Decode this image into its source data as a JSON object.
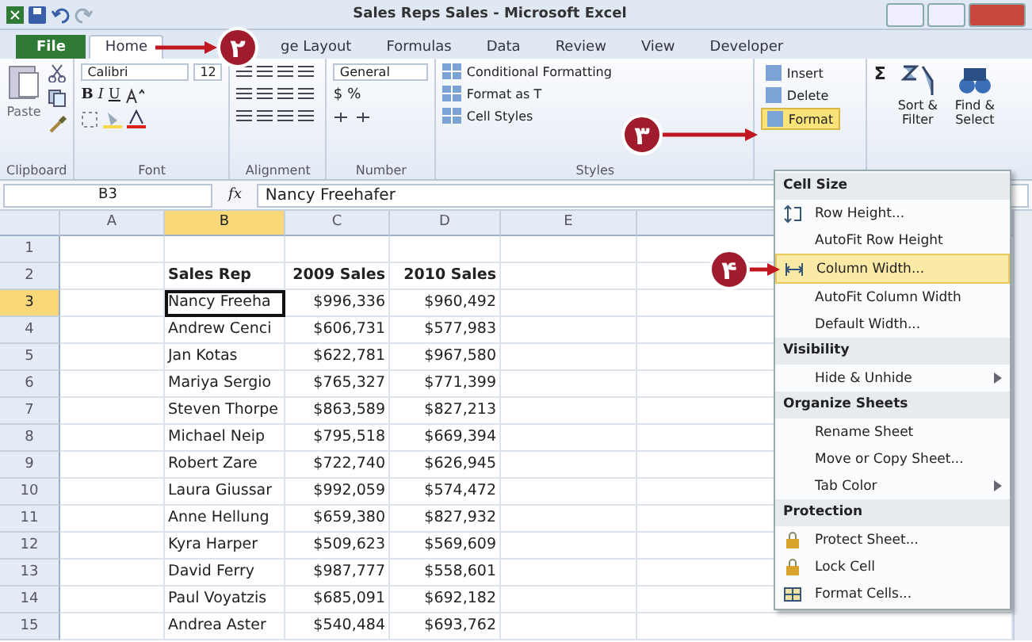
{
  "window": {
    "title": "Sales Reps Sales - Microsoft Excel"
  },
  "tabs": [
    {
      "label": "File",
      "kind": "file",
      "selected": false
    },
    {
      "label": "Home",
      "kind": "tab",
      "selected": true
    },
    {
      "label": "ge Layout",
      "kind": "tab",
      "selected": false
    },
    {
      "label": "Formulas",
      "kind": "tab",
      "selected": false
    },
    {
      "label": "Data",
      "kind": "tab",
      "selected": false
    },
    {
      "label": "Review",
      "kind": "tab",
      "selected": false
    },
    {
      "label": "View",
      "kind": "tab",
      "selected": false
    },
    {
      "label": "Developer",
      "kind": "tab",
      "selected": false
    }
  ],
  "ribbon": {
    "clipboard": {
      "paste": "Paste",
      "label": "Clipboard"
    },
    "font": {
      "name": "Calibri",
      "size": "12",
      "bold": "B",
      "italic": "I",
      "underline": "U",
      "label": "Font"
    },
    "alignment": {
      "label": "Alignment"
    },
    "number": {
      "format": "General",
      "currency": "$",
      "percent": "%",
      "label": "Number"
    },
    "styles": {
      "items": [
        "Conditional Formatting",
        "Format as T",
        "Cell Styles"
      ],
      "label": "Styles"
    },
    "cells": [
      {
        "label": "Insert",
        "selected": false
      },
      {
        "label": "Delete",
        "selected": false
      },
      {
        "label": "Format",
        "selected": true
      }
    ],
    "editing": {
      "sum": "Σ",
      "sort": "Sort & Filter",
      "find": "Find & Select"
    }
  },
  "formula_bar": {
    "name_box": "B3",
    "fx": "fx",
    "value": "Nancy Freehafer"
  },
  "columns": [
    {
      "label": "A",
      "selected": false
    },
    {
      "label": "B",
      "selected": true
    },
    {
      "label": "C",
      "selected": false
    },
    {
      "label": "D",
      "selected": false
    },
    {
      "label": "E",
      "selected": false
    }
  ],
  "rows": [
    {
      "num": "1",
      "kind": "blank",
      "selected": false
    },
    {
      "num": "2",
      "kind": "header",
      "selected": false,
      "rep": "Sales Rep",
      "y2009": "2009 Sales",
      "y2010": "2010 Sales"
    },
    {
      "num": "3",
      "kind": "data",
      "selected": true,
      "rep": "Nancy Freeha",
      "y2009": "$996,336",
      "y2010": "$960,492"
    },
    {
      "num": "4",
      "kind": "data",
      "selected": false,
      "rep": "Andrew Cenci",
      "y2009": "$606,731",
      "y2010": "$577,983"
    },
    {
      "num": "5",
      "kind": "data",
      "selected": false,
      "rep": "Jan Kotas",
      "y2009": "$622,781",
      "y2010": "$967,580"
    },
    {
      "num": "6",
      "kind": "data",
      "selected": false,
      "rep": "Mariya Sergio",
      "y2009": "$765,327",
      "y2010": "$771,399"
    },
    {
      "num": "7",
      "kind": "data",
      "selected": false,
      "rep": "Steven Thorpe",
      "y2009": "$863,589",
      "y2010": "$827,213"
    },
    {
      "num": "8",
      "kind": "data",
      "selected": false,
      "rep": "Michael Neip",
      "y2009": "$795,518",
      "y2010": "$669,394"
    },
    {
      "num": "9",
      "kind": "data",
      "selected": false,
      "rep": "Robert Zare",
      "y2009": "$722,740",
      "y2010": "$626,945"
    },
    {
      "num": "10",
      "kind": "data",
      "selected": false,
      "rep": "Laura Giussar",
      "y2009": "$992,059",
      "y2010": "$574,472"
    },
    {
      "num": "11",
      "kind": "data",
      "selected": false,
      "rep": "Anne Hellung",
      "y2009": "$659,380",
      "y2010": "$827,932"
    },
    {
      "num": "12",
      "kind": "data",
      "selected": false,
      "rep": "Kyra Harper",
      "y2009": "$509,623",
      "y2010": "$569,609"
    },
    {
      "num": "13",
      "kind": "data",
      "selected": false,
      "rep": "David Ferry",
      "y2009": "$987,777",
      "y2010": "$558,601"
    },
    {
      "num": "14",
      "kind": "data",
      "selected": false,
      "rep": "Paul Voyatzis",
      "y2009": "$685,091",
      "y2010": "$692,182"
    },
    {
      "num": "15",
      "kind": "data",
      "selected": false,
      "rep": "Andrea Aster",
      "y2009": "$540,484",
      "y2010": "$693,762"
    }
  ],
  "format_menu": [
    {
      "kind": "heading",
      "label": "Cell Size"
    },
    {
      "kind": "rowheight",
      "label": "Row Height...",
      "submenu": false,
      "selected": false
    },
    {
      "kind": "plain",
      "label": "AutoFit Row Height",
      "submenu": false,
      "selected": false
    },
    {
      "kind": "colwidth",
      "label": "Column Width...",
      "submenu": false,
      "selected": true
    },
    {
      "kind": "plain",
      "label": "AutoFit Column Width",
      "submenu": false,
      "selected": false
    },
    {
      "kind": "plain",
      "label": "Default Width...",
      "submenu": false,
      "selected": false
    },
    {
      "kind": "heading",
      "label": "Visibility"
    },
    {
      "kind": "plain",
      "label": "Hide & Unhide",
      "submenu": true,
      "selected": false
    },
    {
      "kind": "heading",
      "label": "Organize Sheets"
    },
    {
      "kind": "plain",
      "label": "Rename Sheet",
      "submenu": false,
      "selected": false
    },
    {
      "kind": "plain",
      "label": "Move or Copy Sheet...",
      "submenu": false,
      "selected": false
    },
    {
      "kind": "plain",
      "label": "Tab Color",
      "submenu": true,
      "selected": false
    },
    {
      "kind": "heading",
      "label": "Protection"
    },
    {
      "kind": "lock",
      "label": "Protect Sheet...",
      "submenu": false,
      "selected": false
    },
    {
      "kind": "lock",
      "label": "Lock Cell",
      "submenu": false,
      "selected": false
    },
    {
      "kind": "cells",
      "label": "Format Cells...",
      "submenu": false,
      "selected": false
    }
  ],
  "callouts": [
    {
      "label": "۲"
    },
    {
      "label": "۳"
    },
    {
      "label": "۴"
    }
  ]
}
